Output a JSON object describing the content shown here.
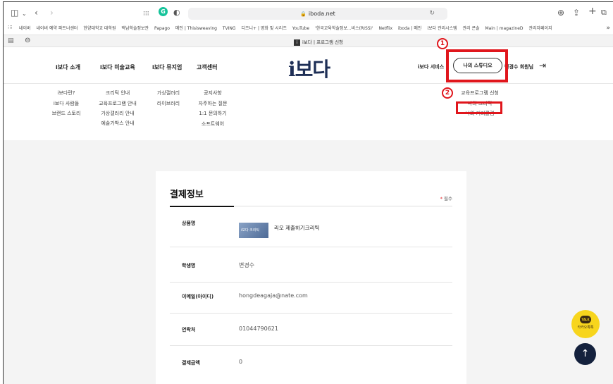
{
  "browser": {
    "url": "iboda.net",
    "icons": {
      "sidebar": "sidebar-icon",
      "back": "back-icon",
      "forward": "forward-icon",
      "grid": "grid-icon",
      "grammarly": "grammarly-icon",
      "shield": "privacy-icon",
      "reload": "reload-icon",
      "download": "download-icon",
      "share": "share-icon",
      "newtab": "plus-icon",
      "tabs": "tabs-icon"
    },
    "bookmarks": [
      "네이버",
      "네이버 예약 파트너센터",
      "한양대학교 대학원",
      "백남학술정보관",
      "Papago",
      "메인 | Thisisweaving",
      "TVING",
      "디즈니+ | 영화 및 시리즈",
      "YouTube",
      "'한국교육학술정보...비스(RISS)'",
      "Netflix",
      "iboda | 메인",
      "i보다 관리시스템",
      "관리 콘솔",
      "Main | magazineD",
      "관리자페이지"
    ],
    "bookmarks_more": "»",
    "tab_title": "i보다 | 프로그램 신청",
    "tab_favicon": "i"
  },
  "site": {
    "logo": "i보다",
    "nav": [
      "i보다 소개",
      "i보다 미술교육",
      "i보다 뮤지엄",
      "고객센터"
    ],
    "service_label": "i보다 서비스",
    "studio_button": "나의 스튜디오",
    "member_label": "변경수 회원님",
    "highlight_badges": [
      "1",
      "2"
    ],
    "submenu": {
      "about": [
        "i보다란?",
        "i보다 사람들",
        "브랜드 스토리"
      ],
      "education": [
        "크리틱 안내",
        "교육프로그램 안내",
        "가상갤러리 안내",
        "예술가박스 안내"
      ],
      "museum": [
        "가상갤러리",
        "라이브러리"
      ],
      "support": [
        "공지사항",
        "자주하는 질문",
        "1:1 문의하기",
        "소프트웨어"
      ],
      "studio": [
        "교육프로그램 신청",
        "나의 크리틱",
        "나의 커리큘럼"
      ]
    }
  },
  "payment": {
    "title": "결제정보",
    "required_star": "*",
    "required_label": "필수",
    "rows": [
      {
        "label": "상품명",
        "value": "리오 제출하기크리틱",
        "thumb_text": "i보다 크리틱"
      },
      {
        "label": "학생명",
        "value": "변경수"
      },
      {
        "label": "이메일(아이디)",
        "value": "hongdeagaja@nate.com"
      },
      {
        "label": "연락처",
        "value": "01044790621"
      },
      {
        "label": "결제금액",
        "value": "0"
      }
    ]
  },
  "floating": {
    "kakao_badge": "TALK",
    "kakao_label": "카카오톡톡",
    "top_arrow": "↑"
  }
}
